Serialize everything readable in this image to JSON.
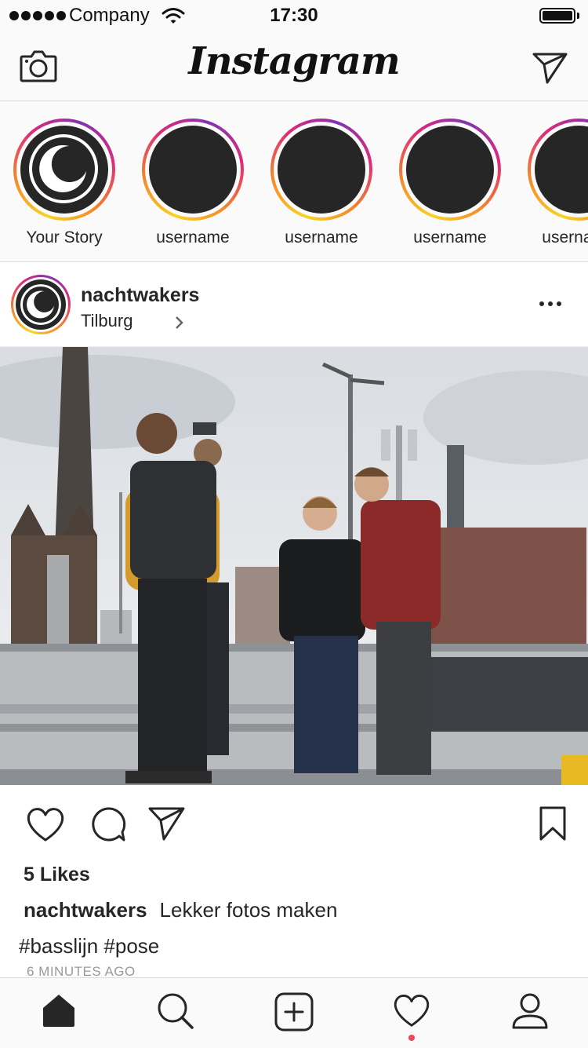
{
  "status_bar": {
    "carrier": "Company",
    "time": "17:30"
  },
  "nav": {
    "logo": "Instagram",
    "camera_icon": "camera-icon",
    "direct_icon": "paper-plane-icon"
  },
  "stories": [
    {
      "label": "Your Story",
      "type": "own"
    },
    {
      "label": "username",
      "type": "friend"
    },
    {
      "label": "username",
      "type": "friend"
    },
    {
      "label": "username",
      "type": "friend"
    },
    {
      "label": "username",
      "type": "friend"
    }
  ],
  "post": {
    "username": "nachtwakers",
    "location": "Tilburg",
    "likes": "5 Likes",
    "caption_user": "nachtwakers",
    "caption_text": "Lekker fotos maken",
    "hashtags": "#basslijn #pose",
    "time_ago": "6 MINUTES AGO"
  },
  "tab_bar": {
    "items": [
      "home-icon",
      "search-icon",
      "add-post-icon",
      "heart-icon",
      "profile-icon"
    ],
    "notification": true
  },
  "colors": {
    "accent_red": "#ed4956",
    "text": "#262626",
    "divider": "#dbdbdb"
  }
}
